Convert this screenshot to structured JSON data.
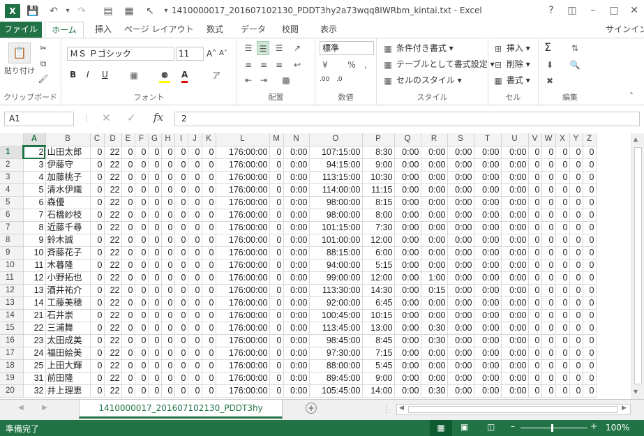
{
  "window": {
    "title": "1410000017_201607102130_PDDT3hy2a73wqq8IWRbm_kintai.txt - Excel",
    "app_icon": "X",
    "signin": "サインイン"
  },
  "menu": {
    "file": "ファイル",
    "tabs": [
      "ホーム",
      "挿入",
      "ページ レイアウト",
      "数式",
      "データ",
      "校閲",
      "表示"
    ]
  },
  "ribbon": {
    "clipboard": {
      "label": "クリップボード",
      "paste": "貼り付け"
    },
    "font": {
      "label": "フォント",
      "name": "ＭＳ Ｐゴシック",
      "size": "11",
      "bold": "B",
      "italic": "I",
      "underline": "U"
    },
    "align": {
      "label": "配置"
    },
    "number": {
      "label": "数値",
      "format": "標準"
    },
    "styles": {
      "label": "スタイル",
      "conditional": "条件付き書式",
      "table": "テーブルとして書式設定",
      "cell": "セルのスタイル"
    },
    "cells": {
      "label": "セル",
      "insert": "挿入",
      "delete": "削除",
      "format": "書式"
    },
    "editing": {
      "label": "編集"
    }
  },
  "formula": {
    "namebox": "A1",
    "value": "2"
  },
  "columns": [
    "A",
    "B",
    "C",
    "D",
    "E",
    "F",
    "G",
    "H",
    "I",
    "J",
    "K",
    "L",
    "M",
    "N",
    "O",
    "P",
    "Q",
    "R",
    "S",
    "T",
    "U",
    "V",
    "W",
    "X",
    "Y",
    "Z"
  ],
  "rows": [
    [
      "1",
      "2",
      "山田太郎",
      "0",
      "22",
      "0",
      "0",
      "0",
      "0",
      "0",
      "0",
      "0",
      "176:00:00",
      "0",
      "0:00",
      "107:15:00",
      "8:30",
      "0:00",
      "0:00",
      "0:00",
      "0:00",
      "0:00",
      "0",
      "0",
      "0",
      "0",
      "0"
    ],
    [
      "2",
      "3",
      "伊藤守",
      "0",
      "22",
      "0",
      "0",
      "0",
      "0",
      "0",
      "0",
      "0",
      "176:00:00",
      "0",
      "0:00",
      "94:15:00",
      "9:00",
      "0:00",
      "0:00",
      "0:00",
      "0:00",
      "0:00",
      "0",
      "0",
      "0",
      "0",
      "0"
    ],
    [
      "3",
      "4",
      "加藤桃子",
      "0",
      "22",
      "0",
      "0",
      "0",
      "0",
      "0",
      "0",
      "0",
      "176:00:00",
      "0",
      "0:00",
      "113:15:00",
      "10:30",
      "0:00",
      "0:00",
      "0:00",
      "0:00",
      "0:00",
      "0",
      "0",
      "0",
      "0",
      "0"
    ],
    [
      "4",
      "5",
      "清水伊織",
      "0",
      "22",
      "0",
      "0",
      "0",
      "0",
      "0",
      "0",
      "0",
      "176:00:00",
      "0",
      "0:00",
      "114:00:00",
      "11:15",
      "0:00",
      "0:00",
      "0:00",
      "0:00",
      "0:00",
      "0",
      "0",
      "0",
      "0",
      "0"
    ],
    [
      "5",
      "6",
      "森優",
      "0",
      "22",
      "0",
      "0",
      "0",
      "0",
      "0",
      "0",
      "0",
      "176:00:00",
      "0",
      "0:00",
      "98:00:00",
      "8:15",
      "0:00",
      "0:00",
      "0:00",
      "0:00",
      "0:00",
      "0",
      "0",
      "0",
      "0",
      "0"
    ],
    [
      "6",
      "7",
      "石橋紗枝",
      "0",
      "22",
      "0",
      "0",
      "0",
      "0",
      "0",
      "0",
      "0",
      "176:00:00",
      "0",
      "0:00",
      "98:00:00",
      "8:00",
      "0:00",
      "0:00",
      "0:00",
      "0:00",
      "0:00",
      "0",
      "0",
      "0",
      "0",
      "0"
    ],
    [
      "7",
      "8",
      "近藤千尋",
      "0",
      "22",
      "0",
      "0",
      "0",
      "0",
      "0",
      "0",
      "0",
      "176:00:00",
      "0",
      "0:00",
      "101:15:00",
      "7:30",
      "0:00",
      "0:00",
      "0:00",
      "0:00",
      "0:00",
      "0",
      "0",
      "0",
      "0",
      "0"
    ],
    [
      "8",
      "9",
      "鈴木誠",
      "0",
      "22",
      "0",
      "0",
      "0",
      "0",
      "0",
      "0",
      "0",
      "176:00:00",
      "0",
      "0:00",
      "101:00:00",
      "12:00",
      "0:00",
      "0:00",
      "0:00",
      "0:00",
      "0:00",
      "0",
      "0",
      "0",
      "0",
      "0"
    ],
    [
      "9",
      "10",
      "斉藤花子",
      "0",
      "22",
      "0",
      "0",
      "0",
      "0",
      "0",
      "0",
      "0",
      "176:00:00",
      "0",
      "0:00",
      "88:15:00",
      "6:00",
      "0:00",
      "0:00",
      "0:00",
      "0:00",
      "0:00",
      "0",
      "0",
      "0",
      "0",
      "0"
    ],
    [
      "10",
      "11",
      "木暮隆",
      "0",
      "22",
      "0",
      "0",
      "0",
      "0",
      "0",
      "0",
      "0",
      "176:00:00",
      "0",
      "0:00",
      "94:00:00",
      "5:15",
      "0:00",
      "0:00",
      "0:00",
      "0:00",
      "0:00",
      "0",
      "0",
      "0",
      "0",
      "0"
    ],
    [
      "11",
      "12",
      "小野拓也",
      "0",
      "22",
      "0",
      "0",
      "0",
      "0",
      "0",
      "0",
      "0",
      "176:00:00",
      "0",
      "0:00",
      "99:00:00",
      "12:00",
      "0:00",
      "1:00",
      "0:00",
      "0:00",
      "0:00",
      "0",
      "0",
      "0",
      "0",
      "0"
    ],
    [
      "12",
      "13",
      "酒井祐介",
      "0",
      "22",
      "0",
      "0",
      "0",
      "0",
      "0",
      "0",
      "0",
      "176:00:00",
      "0",
      "0:00",
      "113:30:00",
      "14:30",
      "0:00",
      "0:15",
      "0:00",
      "0:00",
      "0:00",
      "0",
      "0",
      "0",
      "0",
      "0"
    ],
    [
      "13",
      "14",
      "工藤美穂",
      "0",
      "22",
      "0",
      "0",
      "0",
      "0",
      "0",
      "0",
      "0",
      "176:00:00",
      "0",
      "0:00",
      "92:00:00",
      "6:45",
      "0:00",
      "0:00",
      "0:00",
      "0:00",
      "0:00",
      "0",
      "0",
      "0",
      "0",
      "0"
    ],
    [
      "14",
      "21",
      "石井崇",
      "0",
      "22",
      "0",
      "0",
      "0",
      "0",
      "0",
      "0",
      "0",
      "176:00:00",
      "0",
      "0:00",
      "100:45:00",
      "10:15",
      "0:00",
      "0:00",
      "0:00",
      "0:00",
      "0:00",
      "0",
      "0",
      "0",
      "0",
      "0"
    ],
    [
      "15",
      "22",
      "三浦舞",
      "0",
      "22",
      "0",
      "0",
      "0",
      "0",
      "0",
      "0",
      "0",
      "176:00:00",
      "0",
      "0:00",
      "113:45:00",
      "13:00",
      "0:00",
      "0:30",
      "0:00",
      "0:00",
      "0:00",
      "0",
      "0",
      "0",
      "0",
      "0"
    ],
    [
      "16",
      "23",
      "太田成美",
      "0",
      "22",
      "0",
      "0",
      "0",
      "0",
      "0",
      "0",
      "0",
      "176:00:00",
      "0",
      "0:00",
      "98:45:00",
      "8:45",
      "0:00",
      "0:30",
      "0:00",
      "0:00",
      "0:00",
      "0",
      "0",
      "0",
      "0",
      "0"
    ],
    [
      "17",
      "24",
      "福田絵美",
      "0",
      "22",
      "0",
      "0",
      "0",
      "0",
      "0",
      "0",
      "0",
      "176:00:00",
      "0",
      "0:00",
      "97:30:00",
      "7:15",
      "0:00",
      "0:00",
      "0:00",
      "0:00",
      "0:00",
      "0",
      "0",
      "0",
      "0",
      "0"
    ],
    [
      "18",
      "25",
      "上田大輝",
      "0",
      "22",
      "0",
      "0",
      "0",
      "0",
      "0",
      "0",
      "0",
      "176:00:00",
      "0",
      "0:00",
      "88:00:00",
      "5:45",
      "0:00",
      "0:00",
      "0:00",
      "0:00",
      "0:00",
      "0",
      "0",
      "0",
      "0",
      "0"
    ],
    [
      "19",
      "31",
      "前田隆",
      "0",
      "22",
      "0",
      "0",
      "0",
      "0",
      "0",
      "0",
      "0",
      "176:00:00",
      "0",
      "0:00",
      "89:45:00",
      "9:00",
      "0:00",
      "0:00",
      "0:00",
      "0:00",
      "0:00",
      "0",
      "0",
      "0",
      "0",
      "0"
    ],
    [
      "20",
      "32",
      "井上理恵",
      "0",
      "22",
      "0",
      "0",
      "0",
      "0",
      "0",
      "0",
      "0",
      "176:00:00",
      "0",
      "0:00",
      "105:45:00",
      "14:00",
      "0:00",
      "0:30",
      "0:00",
      "0:00",
      "0:00",
      "0",
      "0",
      "0",
      "0",
      "0"
    ]
  ],
  "sheet": {
    "tab": "1410000017_201607102130_PDDT3hy"
  },
  "status": {
    "text": "準備完了",
    "zoom": "100%"
  }
}
